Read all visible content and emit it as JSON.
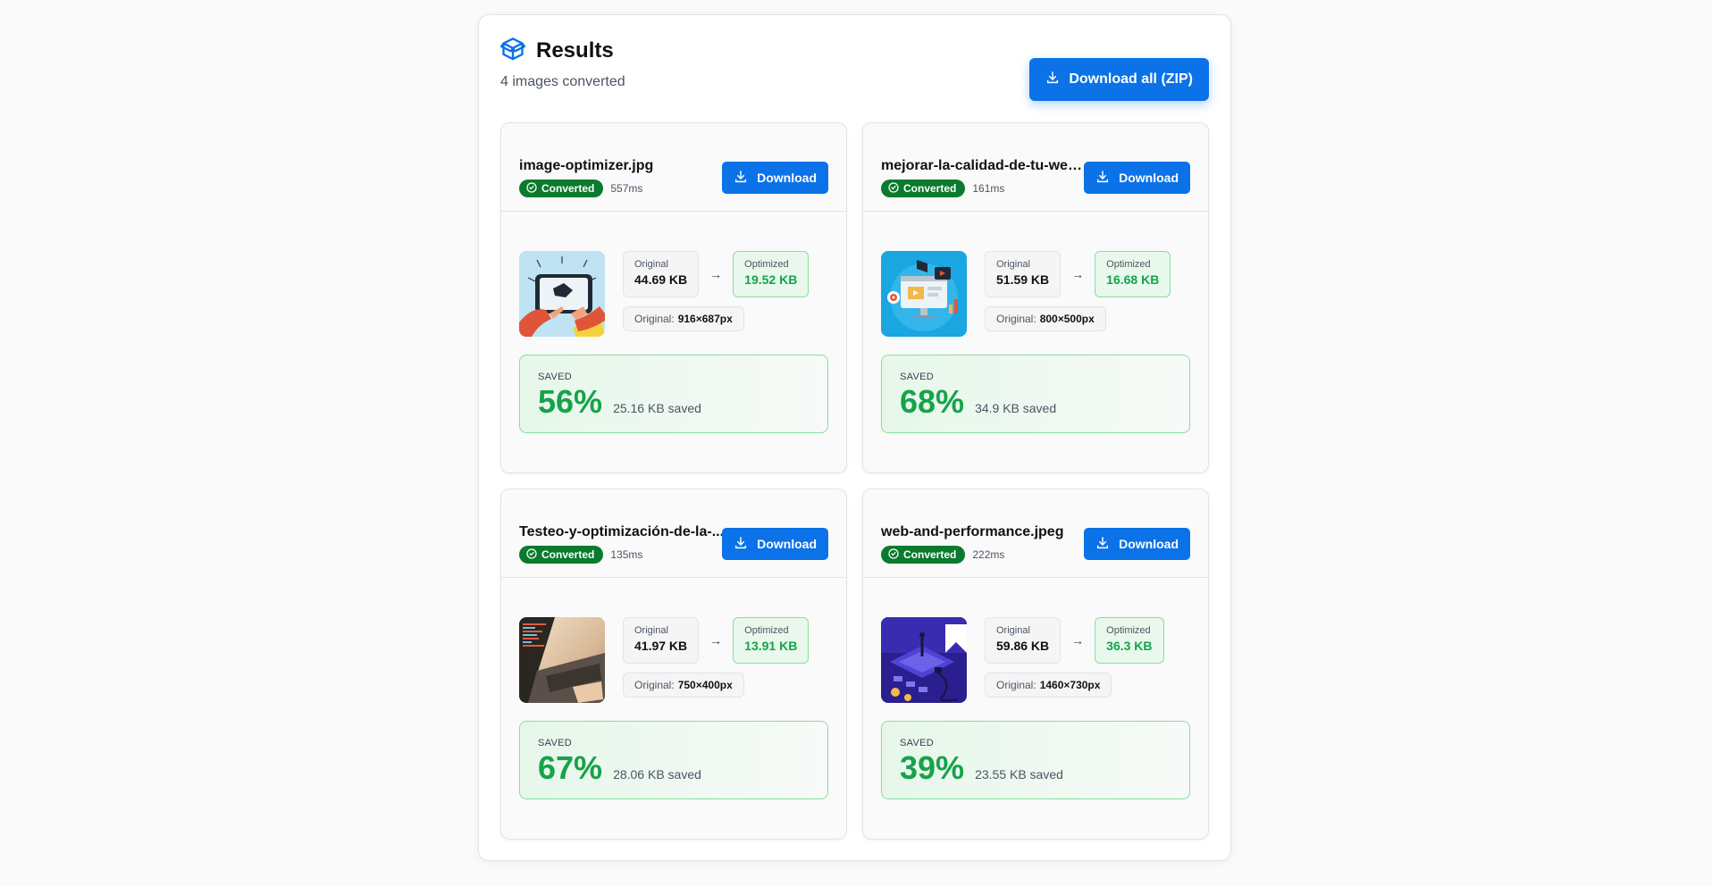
{
  "header": {
    "title": "Results",
    "subtitle": "4 images converted",
    "download_all_label": "Download all (ZIP)"
  },
  "colors": {
    "accent": "#0b72e7",
    "success": "#16a34a",
    "badge": "#0a7a2e"
  },
  "labels": {
    "download": "Download",
    "converted": "Converted",
    "original": "Original",
    "optimized": "Optimized",
    "original_dims": "Original:",
    "saved": "SAVED"
  },
  "files": [
    {
      "name": "image-optimizer.jpg",
      "time": "557ms",
      "original_size": "44.69 KB",
      "optimized_size": "19.52 KB",
      "dims": "916×687px",
      "saved_pct": "56%",
      "saved_kb": "25.16 KB saved",
      "thumb": "tablet-hand-illustration"
    },
    {
      "name": "mejorar-la-calidad-de-tu-web...",
      "time": "161ms",
      "original_size": "51.59 KB",
      "optimized_size": "16.68 KB",
      "dims": "800×500px",
      "saved_pct": "68%",
      "saved_kb": "34.9 KB saved",
      "thumb": "monitor-marketing-illustration"
    },
    {
      "name": "Testeo-y-optimización-de-la-...",
      "time": "135ms",
      "original_size": "41.97 KB",
      "optimized_size": "13.91 KB",
      "dims": "750×400px",
      "saved_pct": "67%",
      "saved_kb": "28.06 KB saved",
      "thumb": "laptop-photo"
    },
    {
      "name": "web-and-performance.jpeg",
      "time": "222ms",
      "original_size": "59.86 KB",
      "optimized_size": "36.3 KB",
      "dims": "1460×730px",
      "saved_pct": "39%",
      "saved_kb": "23.55 KB saved",
      "thumb": "isometric-purple-illustration"
    }
  ]
}
